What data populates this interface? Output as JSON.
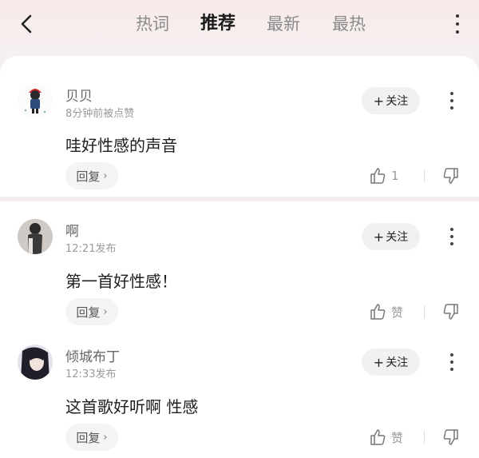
{
  "tabs": [
    {
      "label": "热词",
      "active": false
    },
    {
      "label": "推荐",
      "active": true
    },
    {
      "label": "最新",
      "active": false
    },
    {
      "label": "最热",
      "active": false
    }
  ],
  "comments": [
    {
      "username": "贝贝",
      "meta": "8分钟前被点赞",
      "content": "哇好性感的声音",
      "follow_label": "关注",
      "reply_label": "回复",
      "like_label": "1"
    },
    {
      "username": "啊",
      "meta": "12:21发布",
      "content": "第一首好性感！",
      "follow_label": "关注",
      "reply_label": "回复",
      "like_label": "赞"
    },
    {
      "username": "倾城布丁",
      "meta": "12:33发布",
      "content": "这首歌好听啊 性感",
      "follow_label": "关注",
      "reply_label": "回复",
      "like_label": "赞"
    }
  ],
  "icons": {
    "back": "chevron-left-icon",
    "more": "more-vertical-icon",
    "like": "thumbs-up-icon",
    "dislike": "thumbs-down-icon",
    "follow": "plus-icon",
    "reply_chevron": "chevron-right-icon"
  }
}
